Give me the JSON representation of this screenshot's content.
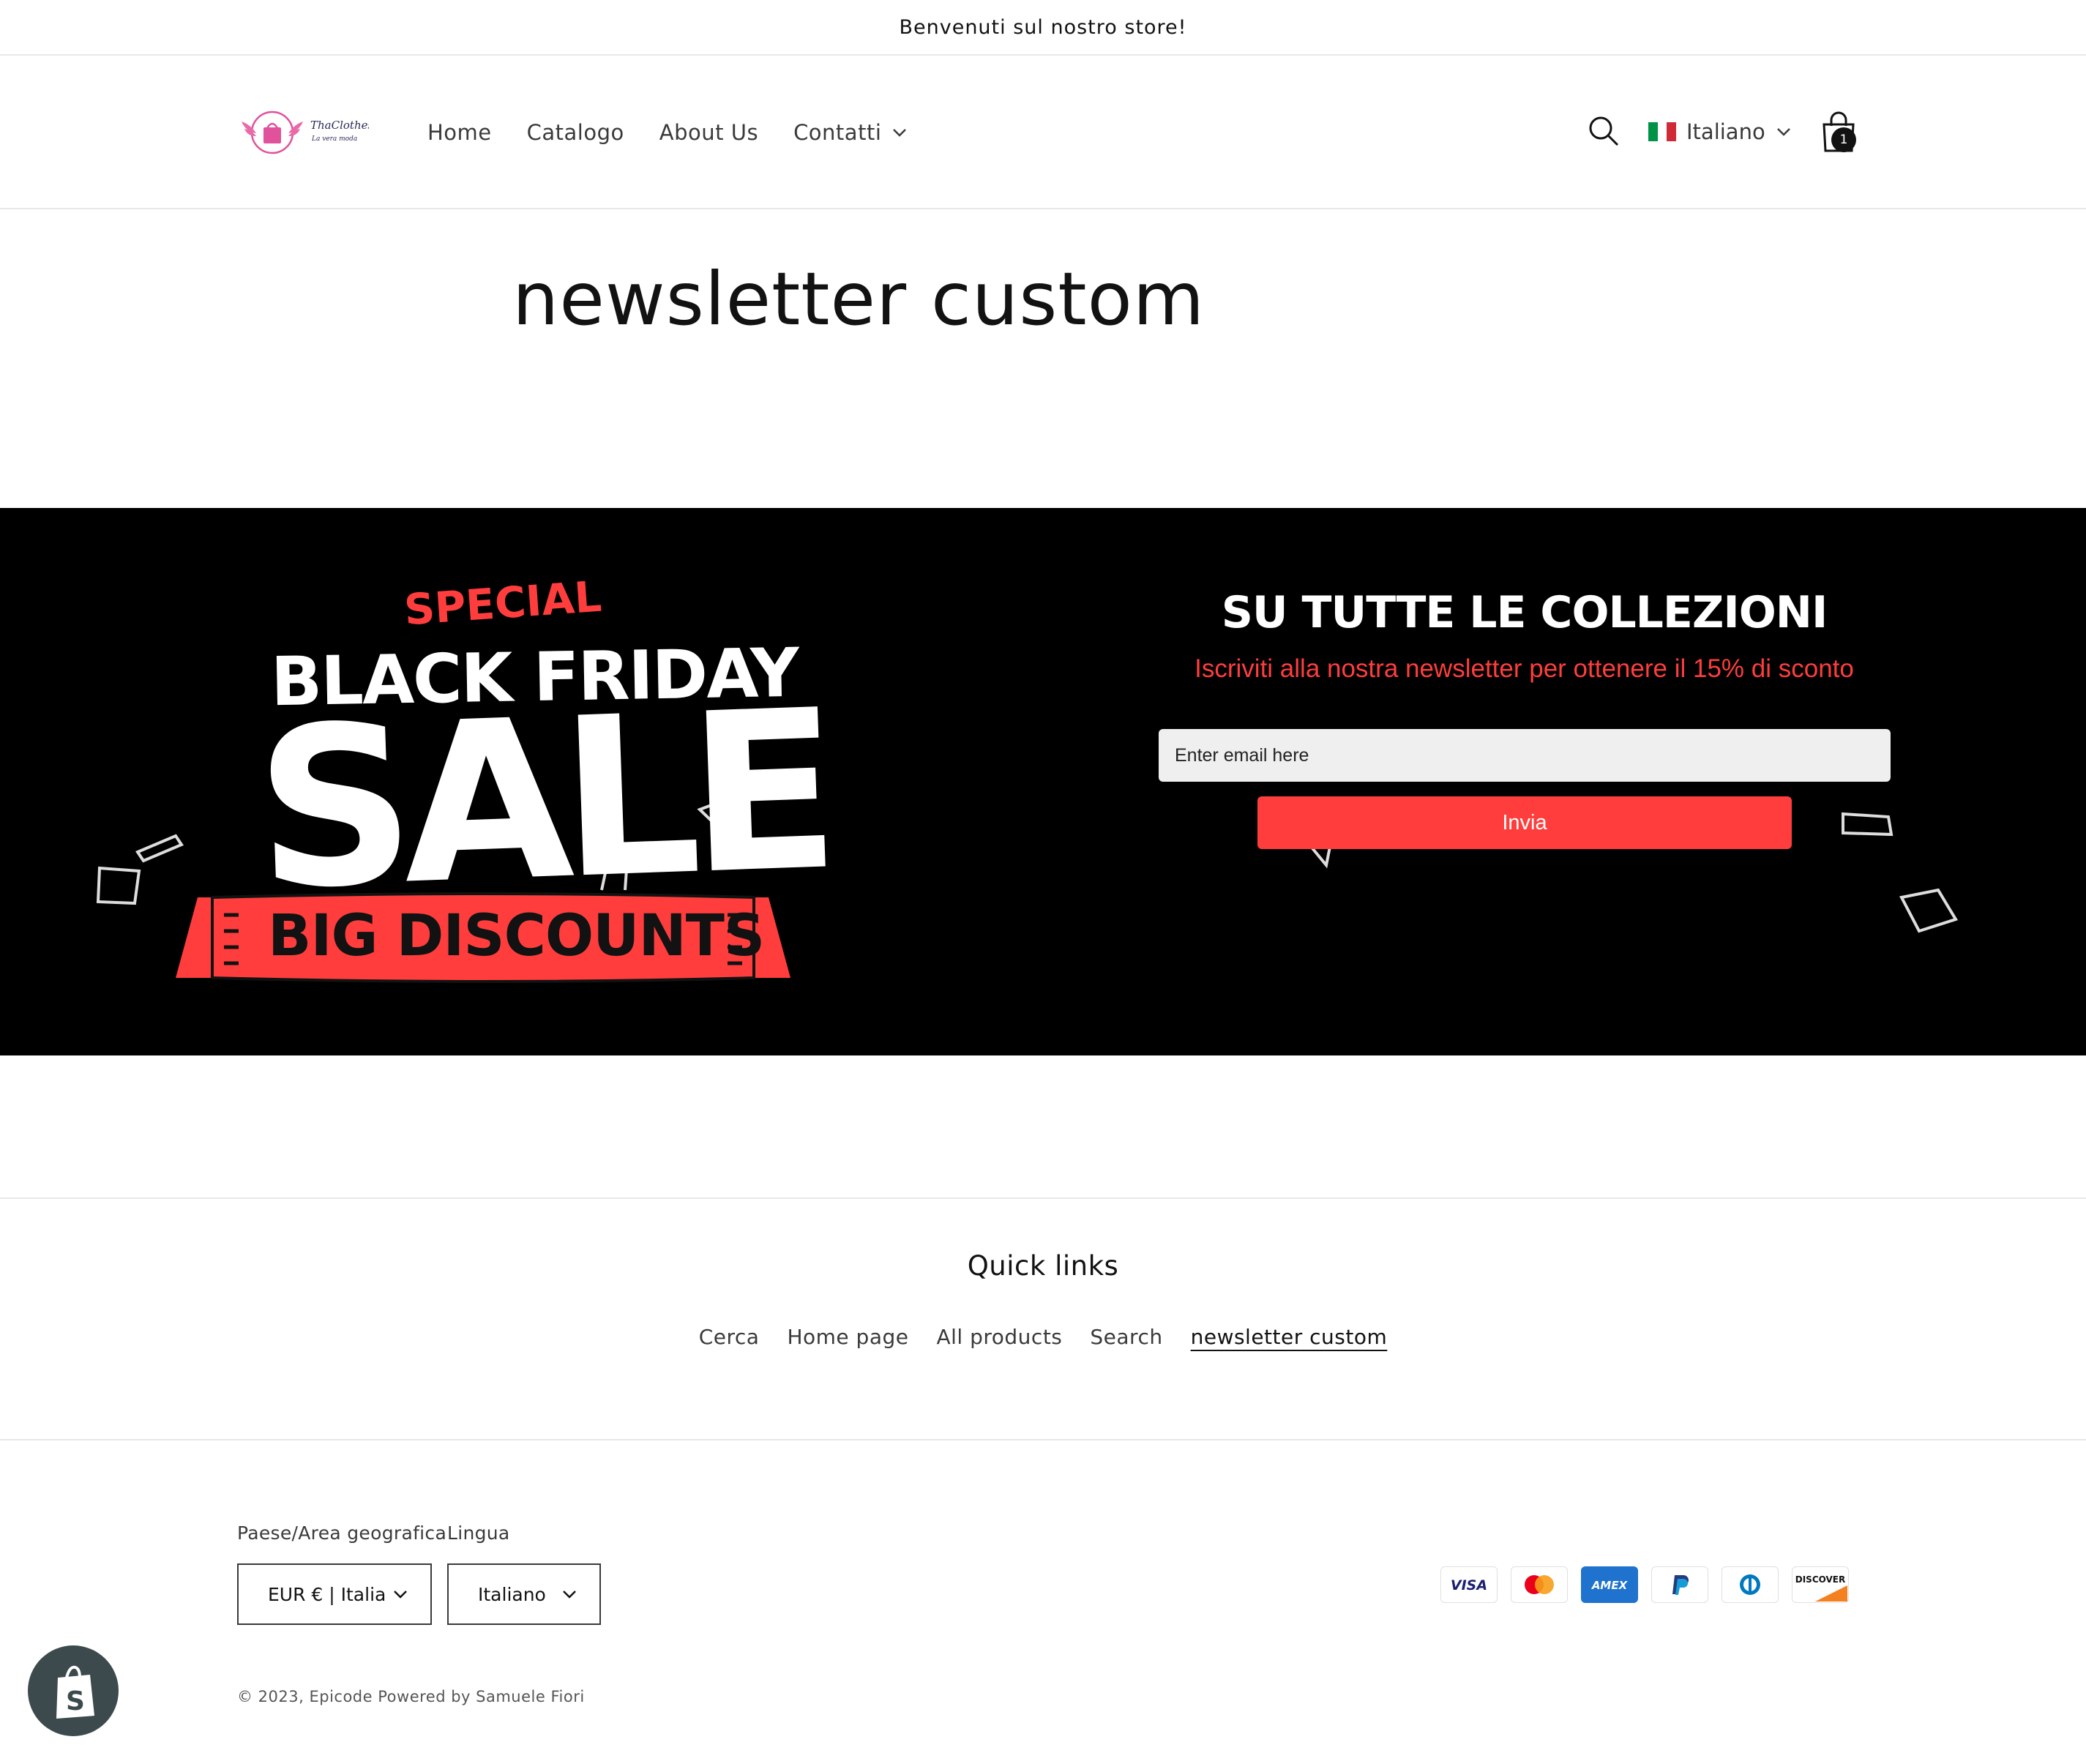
{
  "announcement": "Benvenuti sul nostro store!",
  "header": {
    "logo_alt": "ThaClothes La vera moda",
    "nav": [
      "Home",
      "Catalogo",
      "About Us",
      "Contatti"
    ],
    "language": "Italiano",
    "cart_count": "1"
  },
  "page": {
    "title": "newsletter custom"
  },
  "banner": {
    "special": "SPECIAL",
    "black_friday": "BLACK FRIDAY",
    "sale": "SALE",
    "big_discounts": "BIG DISCOUNTS",
    "headline": "SU TUTTE LE COLLEZIONI",
    "subheadline": "Iscriviti alla nostra newsletter per ottenere il 15% di sconto",
    "email_placeholder": "Enter email here",
    "submit_label": "Invia",
    "accent_color": "#ff3d3d"
  },
  "quick_links": {
    "title": "Quick links",
    "links": [
      "Cerca",
      "Home page",
      "All products",
      "Search",
      "newsletter custom"
    ]
  },
  "footer": {
    "country_label": "Paese/Area geografica",
    "country_value": "EUR € | Italia",
    "language_label": "Lingua",
    "language_value": "Italiano",
    "payments": [
      "VISA",
      "Mastercard",
      "AMEX",
      "PayPal",
      "Diners Club",
      "DISCOVER"
    ],
    "copyright_prefix": "© 2023,",
    "copyright_store": "Epicode",
    "copyright_powered": "Powered by Samuele Fiori"
  }
}
